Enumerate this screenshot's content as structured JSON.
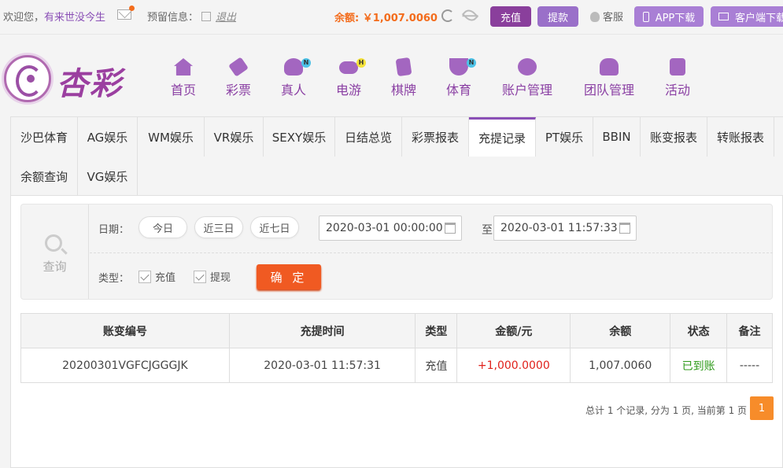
{
  "topbar": {
    "welcome": "欢迎您，",
    "username": "有来世没今生",
    "reserve_label": "预留信息：",
    "logout": "退出",
    "balance_label": "余额:",
    "balance_value": "￥1,007.0060",
    "charge_btn": "充值",
    "withdraw_btn": "提款",
    "service": "客服",
    "app_download": "APP下载",
    "client_download": "客户端下载"
  },
  "logo": {
    "text": "杏彩"
  },
  "nav": [
    {
      "label": "首页",
      "icon": "home-icon"
    },
    {
      "label": "彩票",
      "icon": "lottery-ticket-icon"
    },
    {
      "label": "真人",
      "icon": "live-dealer-icon",
      "badge": "N"
    },
    {
      "label": "电游",
      "icon": "gamepad-icon",
      "badge": "H"
    },
    {
      "label": "棋牌",
      "icon": "cards-icon"
    },
    {
      "label": "体育",
      "icon": "trophy-icon",
      "badge": "N"
    },
    {
      "label": "账户管理",
      "icon": "account-icon"
    },
    {
      "label": "团队管理",
      "icon": "team-icon"
    },
    {
      "label": "活动",
      "icon": "gift-icon"
    }
  ],
  "tabs": [
    "沙巴体育",
    "AG娱乐",
    "WM娱乐",
    "VR娱乐",
    "SEXY娱乐",
    "日结总览",
    "彩票报表",
    "充提记录",
    "PT娱乐",
    "BBIN",
    "账变报表",
    "转账报表",
    "余额查询",
    "VG娱乐"
  ],
  "active_tab": "充提记录",
  "search": {
    "label": "查询",
    "date_label": "日期：",
    "quick_dates": [
      "今日",
      "近三日",
      "近七日"
    ],
    "start_date": "2020-03-01 00:00:00",
    "to_label": "至",
    "end_date": "2020-03-01 11:57:33",
    "type_label": "类型：",
    "type_options": [
      "充值",
      "提现"
    ],
    "confirm": "确 定"
  },
  "table": {
    "headers": [
      "账变编号",
      "充提时间",
      "类型",
      "金额/元",
      "余额",
      "状态",
      "备注"
    ],
    "rows": [
      [
        "20200301VGFCJGGGJK",
        "2020-03-01 11:57:31",
        "充值",
        "+1,000.0000",
        "1,007.0060",
        "已到账",
        "-----"
      ]
    ]
  },
  "pager": {
    "summary": "总计 1 个记录, 分为 1 页, 当前第 1 页",
    "current_page": "1"
  },
  "colors": {
    "brand_purple": "#8a3fa3",
    "accent_orange": "#f05a22",
    "amount_red": "#e0211b",
    "status_green": "#2e9a1a"
  }
}
